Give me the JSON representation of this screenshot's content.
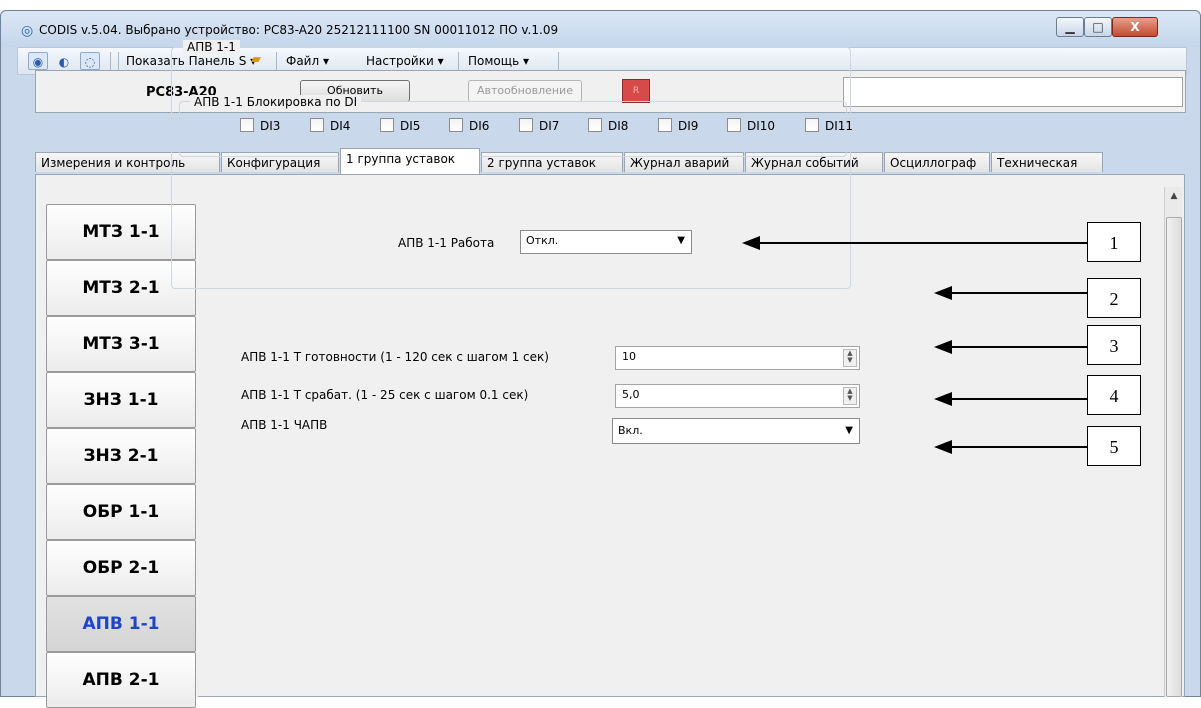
{
  "window": {
    "title": "CODIS v.5.04.  Выбрано устройство: PC83-A20  25212111100  SN 00011012  ПО v.1.09",
    "min_label": "▁",
    "max_label": "□",
    "close_label": "X"
  },
  "toolbar": {
    "show_panel": "Показать Панель S",
    "file_menu": "Файл",
    "settings_menu": "Настройки",
    "help_menu": "Помощь"
  },
  "device_panel": {
    "device_name": "PC83-A20",
    "refresh_button": "Обновить",
    "autorefresh_button": "Автообновление",
    "status_led": "R"
  },
  "tabs": [
    {
      "label": "Измерения и контроль"
    },
    {
      "label": "Конфигурация"
    },
    {
      "label": "1 группа уставок"
    },
    {
      "label": "2 группа уставок"
    },
    {
      "label": "Журнал аварий"
    },
    {
      "label": "Журнал событий"
    },
    {
      "label": "Осциллограф"
    },
    {
      "label": "Техническая"
    }
  ],
  "sidebar": {
    "items": [
      {
        "label": "МТЗ 1-1"
      },
      {
        "label": "МТЗ 2-1"
      },
      {
        "label": "МТЗ 3-1"
      },
      {
        "label": "ЗНЗ 1-1"
      },
      {
        "label": "ЗНЗ 2-1"
      },
      {
        "label": "ОБР 1-1"
      },
      {
        "label": "ОБР 2-1"
      },
      {
        "label": "АПВ 1-1"
      },
      {
        "label": "АПВ 2-1"
      }
    ],
    "active_index": 7
  },
  "apv": {
    "group_title": "АПВ 1-1",
    "work_label": "АПВ 1-1 Работа",
    "work_value": "Откл.",
    "block_title": "АПВ 1-1 Блокировка по DI",
    "di": [
      "DI3",
      "DI4",
      "DI5",
      "DI6",
      "DI7",
      "DI8",
      "DI9",
      "DI10",
      "DI11"
    ],
    "t_ready_label": "АПВ 1-1 Т готовности (1 - 120 сек с шагом 1 сек)",
    "t_ready_value": "10",
    "t_trip_label": "АПВ 1-1 Т срабат.  (1 - 25 сек с шагом 0.1 сек)",
    "t_trip_value": "5,0",
    "chapv_label": "АПВ 1-1 ЧАПВ",
    "chapv_value": "Вкл."
  },
  "callouts": [
    "1",
    "2",
    "3",
    "4",
    "5"
  ]
}
